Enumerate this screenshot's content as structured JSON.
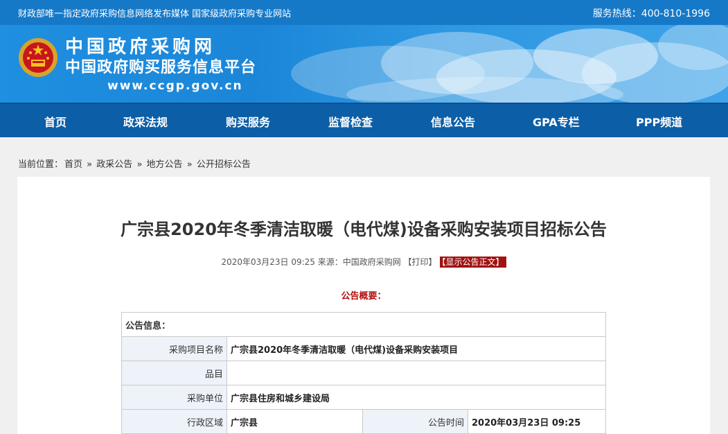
{
  "topbar": {
    "left_text": "财政部唯一指定政府采购信息网络发布媒体 国家级政府采购专业网站",
    "hotline": "服务热线：400-810-1996"
  },
  "banner": {
    "title": "中国政府采购网",
    "subtitle": "中国政府购买服务信息平台",
    "url": "www.ccgp.gov.cn"
  },
  "nav": {
    "items": [
      "首页",
      "政采法规",
      "购买服务",
      "监督检查",
      "信息公告",
      "GPA专栏",
      "PPP频道"
    ]
  },
  "breadcrumb": {
    "prefix": "当前位置：",
    "items": [
      "首页",
      "政采公告",
      "地方公告",
      "公开招标公告"
    ],
    "separator": "»"
  },
  "article": {
    "title": "广宗县2020年冬季清洁取暖（电代煤)设备采购安装项目招标公告",
    "meta_text": "2020年03月23日 09:25 来源：中国政府采购网 【打印】",
    "show_body_label": "【显示公告正文】",
    "overview_label": "公告概要："
  },
  "info_table": {
    "header": "公告信息：",
    "rows": [
      {
        "label": "采购项目名称",
        "value": "广宗县2020年冬季清洁取暖（电代煤)设备采购安装项目"
      },
      {
        "label": "品目",
        "value": ""
      },
      {
        "label": "采购单位",
        "value": "广宗县住房和城乡建设局"
      }
    ],
    "split_row": {
      "label1": "行政区域",
      "value1": "广宗县",
      "label2": "公告时间",
      "value2": "2020年03月23日 09:25"
    }
  },
  "colors": {
    "topbar": "#1679c8",
    "nav": "#0c5ea6",
    "accent_red": "#a11212"
  }
}
